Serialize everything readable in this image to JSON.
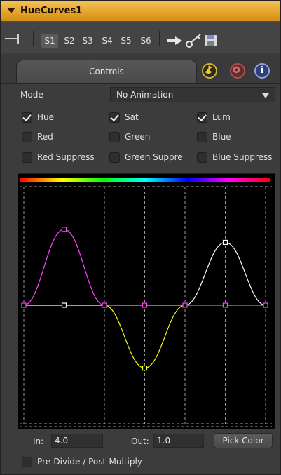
{
  "header": {
    "title": "HueCurves1"
  },
  "toolbar": {
    "slots": [
      "S1",
      "S2",
      "S3",
      "S4",
      "S5",
      "S6"
    ],
    "active_slot": "S1"
  },
  "tabs": {
    "controls_label": "Controls"
  },
  "mode": {
    "label": "Mode",
    "value": "No Animation"
  },
  "channels": [
    {
      "label": "Hue",
      "checked": true
    },
    {
      "label": "Sat",
      "checked": true
    },
    {
      "label": "Lum",
      "checked": true
    },
    {
      "label": "Red",
      "checked": false
    },
    {
      "label": "Green",
      "checked": false
    },
    {
      "label": "Blue",
      "checked": false
    },
    {
      "label": "Red Suppress",
      "checked": false
    },
    {
      "label": "Green Suppre",
      "checked": false
    },
    {
      "label": "Blue Suppress",
      "checked": false
    }
  ],
  "curves": {
    "colors": {
      "hue": "#ff44ff",
      "sat": "#ffff00",
      "lum": "#ffffff"
    },
    "hue_points": [
      [
        0,
        0.5
      ],
      [
        0.1667,
        0.82
      ],
      [
        0.3333,
        0.5
      ],
      [
        0.5,
        0.5
      ],
      [
        0.6667,
        0.5
      ],
      [
        0.8333,
        0.5
      ],
      [
        1,
        0.5
      ]
    ],
    "sat_points": [
      [
        0.3333,
        0.5
      ],
      [
        0.5,
        0.235
      ],
      [
        0.6667,
        0.5
      ]
    ],
    "lum_points": [
      [
        0,
        0.5
      ],
      [
        0.1667,
        0.5
      ],
      [
        0.3333,
        0.5
      ],
      [
        0.6667,
        0.5
      ],
      [
        0.8333,
        0.765
      ],
      [
        1,
        0.5
      ]
    ]
  },
  "io": {
    "in_label": "In:",
    "in_value": "4.0",
    "out_label": "Out:",
    "out_value": "1.0",
    "pick_label": "Pick Color"
  },
  "option": {
    "label": "Pre-Divide / Post-Multiply",
    "checked": false
  }
}
